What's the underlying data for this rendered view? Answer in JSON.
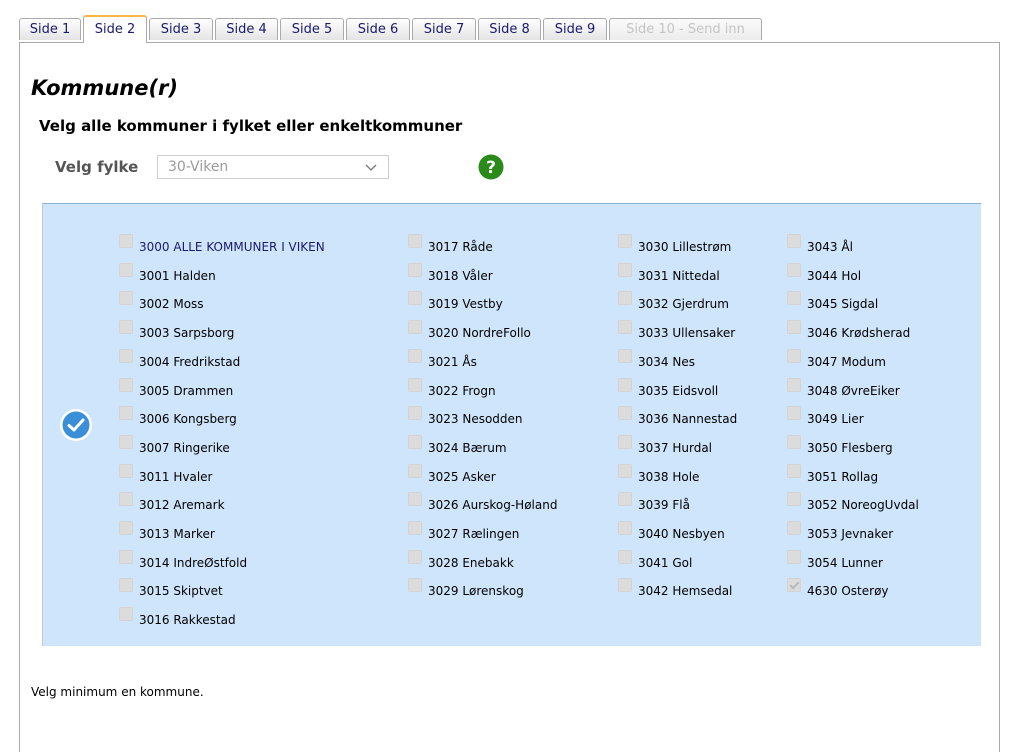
{
  "tabs": [
    {
      "label": "Side 1",
      "state": "normal"
    },
    {
      "label": "Side 2",
      "state": "active"
    },
    {
      "label": "Side 3",
      "state": "normal"
    },
    {
      "label": "Side 4",
      "state": "normal"
    },
    {
      "label": "Side 5",
      "state": "normal"
    },
    {
      "label": "Side 6",
      "state": "normal"
    },
    {
      "label": "Side 7",
      "state": "normal"
    },
    {
      "label": "Side 8",
      "state": "normal"
    },
    {
      "label": "Side 9",
      "state": "normal"
    },
    {
      "label": "Side 10 - Send inn",
      "state": "disabled"
    }
  ],
  "page": {
    "title": "Kommune(r)",
    "subtitle": "Velg alle kommuner i fylket eller enkeltkommuner",
    "footer_message": "Velg minimum en kommune."
  },
  "fylke": {
    "label": "Velg fylke",
    "selected": "30-Viken"
  },
  "icons": {
    "help": "question-mark-icon",
    "check_all": "check-circle-icon",
    "dropdown": "chevron-down-icon"
  },
  "colors": {
    "help_green": "#2a8a1a",
    "check_blue": "#3a8fd6",
    "list_bg": "#cfe5fb",
    "active_tab_accent": "#f7b646"
  },
  "municipality_columns": [
    [
      {
        "label": "3000 ALLE KOMMUNER I VIKEN",
        "checked": false
      },
      {
        "label": "3001 Halden",
        "checked": false
      },
      {
        "label": "3002 Moss",
        "checked": false
      },
      {
        "label": "3003 Sarpsborg",
        "checked": false
      },
      {
        "label": "3004 Fredrikstad",
        "checked": false
      },
      {
        "label": "3005 Drammen",
        "checked": false
      },
      {
        "label": "3006 Kongsberg",
        "checked": false
      },
      {
        "label": "3007 Ringerike",
        "checked": false
      },
      {
        "label": "3011 Hvaler",
        "checked": false
      },
      {
        "label": "3012 Aremark",
        "checked": false
      },
      {
        "label": "3013 Marker",
        "checked": false
      },
      {
        "label": "3014 IndreØstfold",
        "checked": false
      },
      {
        "label": "3015 Skiptvet",
        "checked": false
      },
      {
        "label": "3016 Rakkestad",
        "checked": false
      }
    ],
    [
      {
        "label": "3017 Råde",
        "checked": false
      },
      {
        "label": "3018 Våler",
        "checked": false
      },
      {
        "label": "3019 Vestby",
        "checked": false
      },
      {
        "label": "3020 NordreFollo",
        "checked": false
      },
      {
        "label": "3021 Ås",
        "checked": false
      },
      {
        "label": "3022 Frogn",
        "checked": false
      },
      {
        "label": "3023 Nesodden",
        "checked": false
      },
      {
        "label": "3024 Bærum",
        "checked": false
      },
      {
        "label": "3025 Asker",
        "checked": false
      },
      {
        "label": "3026 Aurskog-Høland",
        "checked": false
      },
      {
        "label": "3027 Rælingen",
        "checked": false
      },
      {
        "label": "3028 Enebakk",
        "checked": false
      },
      {
        "label": "3029 Lørenskog",
        "checked": false
      }
    ],
    [
      {
        "label": "3030 Lillestrøm",
        "checked": false
      },
      {
        "label": "3031 Nittedal",
        "checked": false
      },
      {
        "label": "3032 Gjerdrum",
        "checked": false
      },
      {
        "label": "3033 Ullensaker",
        "checked": false
      },
      {
        "label": "3034 Nes",
        "checked": false
      },
      {
        "label": "3035 Eidsvoll",
        "checked": false
      },
      {
        "label": "3036 Nannestad",
        "checked": false
      },
      {
        "label": "3037 Hurdal",
        "checked": false
      },
      {
        "label": "3038 Hole",
        "checked": false
      },
      {
        "label": "3039 Flå",
        "checked": false
      },
      {
        "label": "3040 Nesbyen",
        "checked": false
      },
      {
        "label": "3041 Gol",
        "checked": false
      },
      {
        "label": "3042 Hemsedal",
        "checked": false
      }
    ],
    [
      {
        "label": "3043 Ål",
        "checked": false
      },
      {
        "label": "3044 Hol",
        "checked": false
      },
      {
        "label": "3045 Sigdal",
        "checked": false
      },
      {
        "label": "3046 Krødsherad",
        "checked": false
      },
      {
        "label": "3047 Modum",
        "checked": false
      },
      {
        "label": "3048 ØvreEiker",
        "checked": false
      },
      {
        "label": "3049 Lier",
        "checked": false
      },
      {
        "label": "3050 Flesberg",
        "checked": false
      },
      {
        "label": "3051 Rollag",
        "checked": false
      },
      {
        "label": "3052 NoreogUvdal",
        "checked": false
      },
      {
        "label": "3053 Jevnaker",
        "checked": false
      },
      {
        "label": "3054 Lunner",
        "checked": false
      },
      {
        "label": "4630 Osterøy",
        "checked": true
      }
    ]
  ]
}
